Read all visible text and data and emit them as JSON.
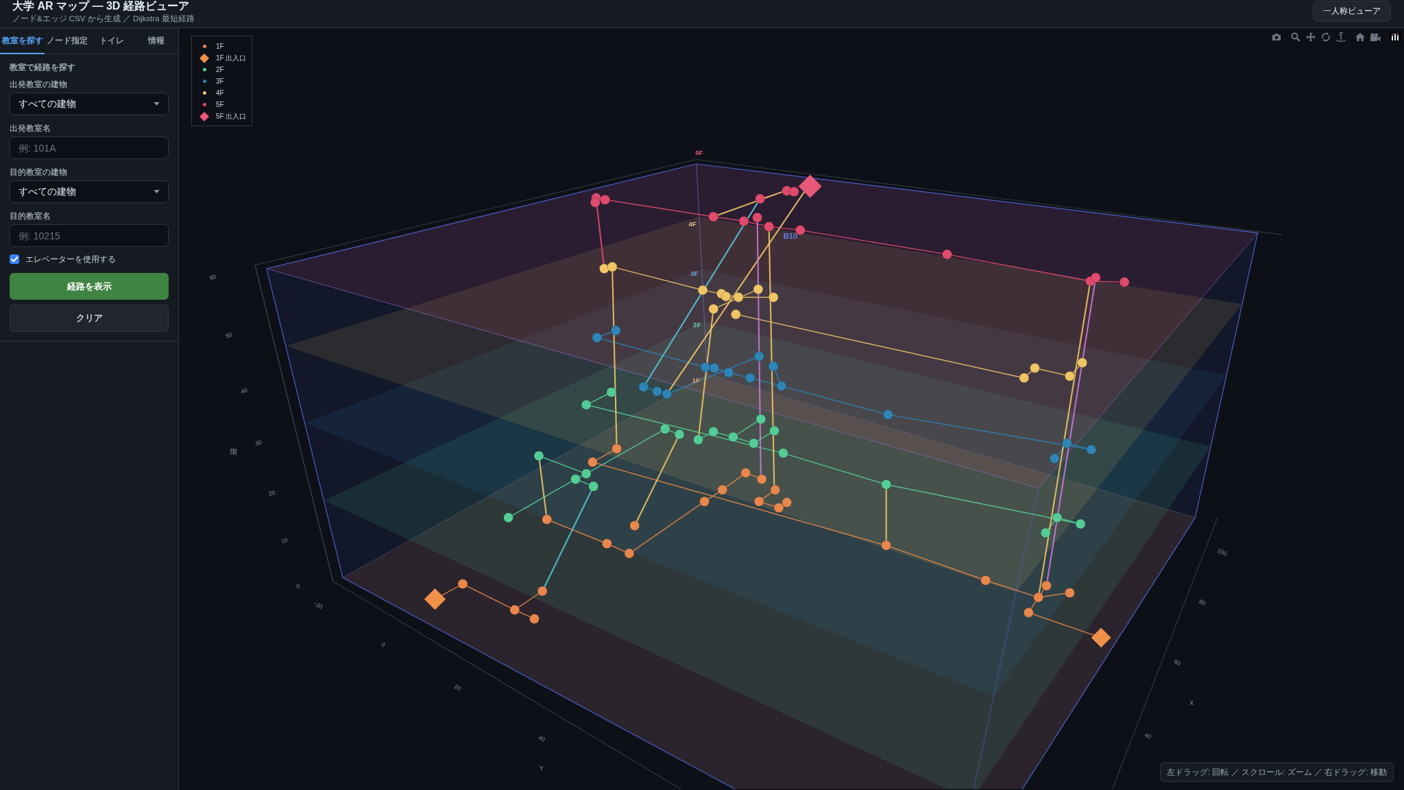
{
  "header": {
    "title": "大学 AR マップ — 3D 経路ビューア",
    "subtitle": "ノード&エッジ CSV から生成 ／ Dijkstra 最短経路",
    "button": "一人称ビューア"
  },
  "sidebar": {
    "tabs": [
      {
        "label": "教室を探す",
        "selected": true
      },
      {
        "label": "ノード指定",
        "selected": false
      },
      {
        "label": "トイレ",
        "selected": false
      },
      {
        "label": "情報",
        "selected": false
      }
    ],
    "section_title": "教室で経路を探す",
    "fields": [
      {
        "kind": "select",
        "label": "出発教室の建物",
        "value": "すべての建物"
      },
      {
        "kind": "input",
        "label": "出発教室名",
        "placeholder": "例: 101A"
      },
      {
        "kind": "select",
        "label": "目的教室の建物",
        "value": "すべての建物"
      },
      {
        "kind": "input",
        "label": "目的教室名",
        "placeholder": "例: 10215"
      }
    ],
    "elevator_option": {
      "label": "エレベーターを使用する",
      "checked": true
    },
    "buttons": [
      {
        "kind": "primary",
        "label": "経路を表示"
      },
      {
        "kind": "secondary",
        "label": "クリア"
      }
    ]
  },
  "scene": {
    "legend": [
      {
        "label": "1F",
        "kind": "dot",
        "color": "#e8874d"
      },
      {
        "label": "1F 出入口",
        "kind": "diamond",
        "color": "#f0914a"
      },
      {
        "label": "2F",
        "kind": "dot",
        "color": "#55cc96"
      },
      {
        "label": "3F",
        "kind": "dot",
        "color": "#2f84b6"
      },
      {
        "label": "4F",
        "kind": "dot",
        "color": "#f0c566"
      },
      {
        "label": "5F",
        "kind": "dot",
        "color": "#e04a6c"
      },
      {
        "label": "5F 出入口",
        "kind": "diamond",
        "color": "#e8587a"
      }
    ],
    "floor_labels": [
      {
        "label": "5F",
        "color": "#e8557a"
      },
      {
        "label": "4F",
        "color": "#e0c48e"
      },
      {
        "label": "3F",
        "color": "#6aa8e0"
      },
      {
        "label": "2F",
        "color": "#72d0b0"
      },
      {
        "label": "1F",
        "color": "#f0a870"
      }
    ],
    "node_label": "B10",
    "axes": {
      "z": {
        "title": "階",
        "ticks": [
          "60",
          "50",
          "40",
          "30",
          "20",
          "10",
          "0"
        ]
      },
      "y": {
        "title": "Y",
        "ticks": [
          "−20",
          "0",
          "20",
          "40"
        ]
      },
      "x": {
        "title": "X",
        "ticks": [
          "100",
          "80",
          "60",
          "40"
        ]
      }
    },
    "hint": "左ドラッグ: 回転 ／ スクロール: ズーム ／ 右ドラッグ: 移動"
  }
}
